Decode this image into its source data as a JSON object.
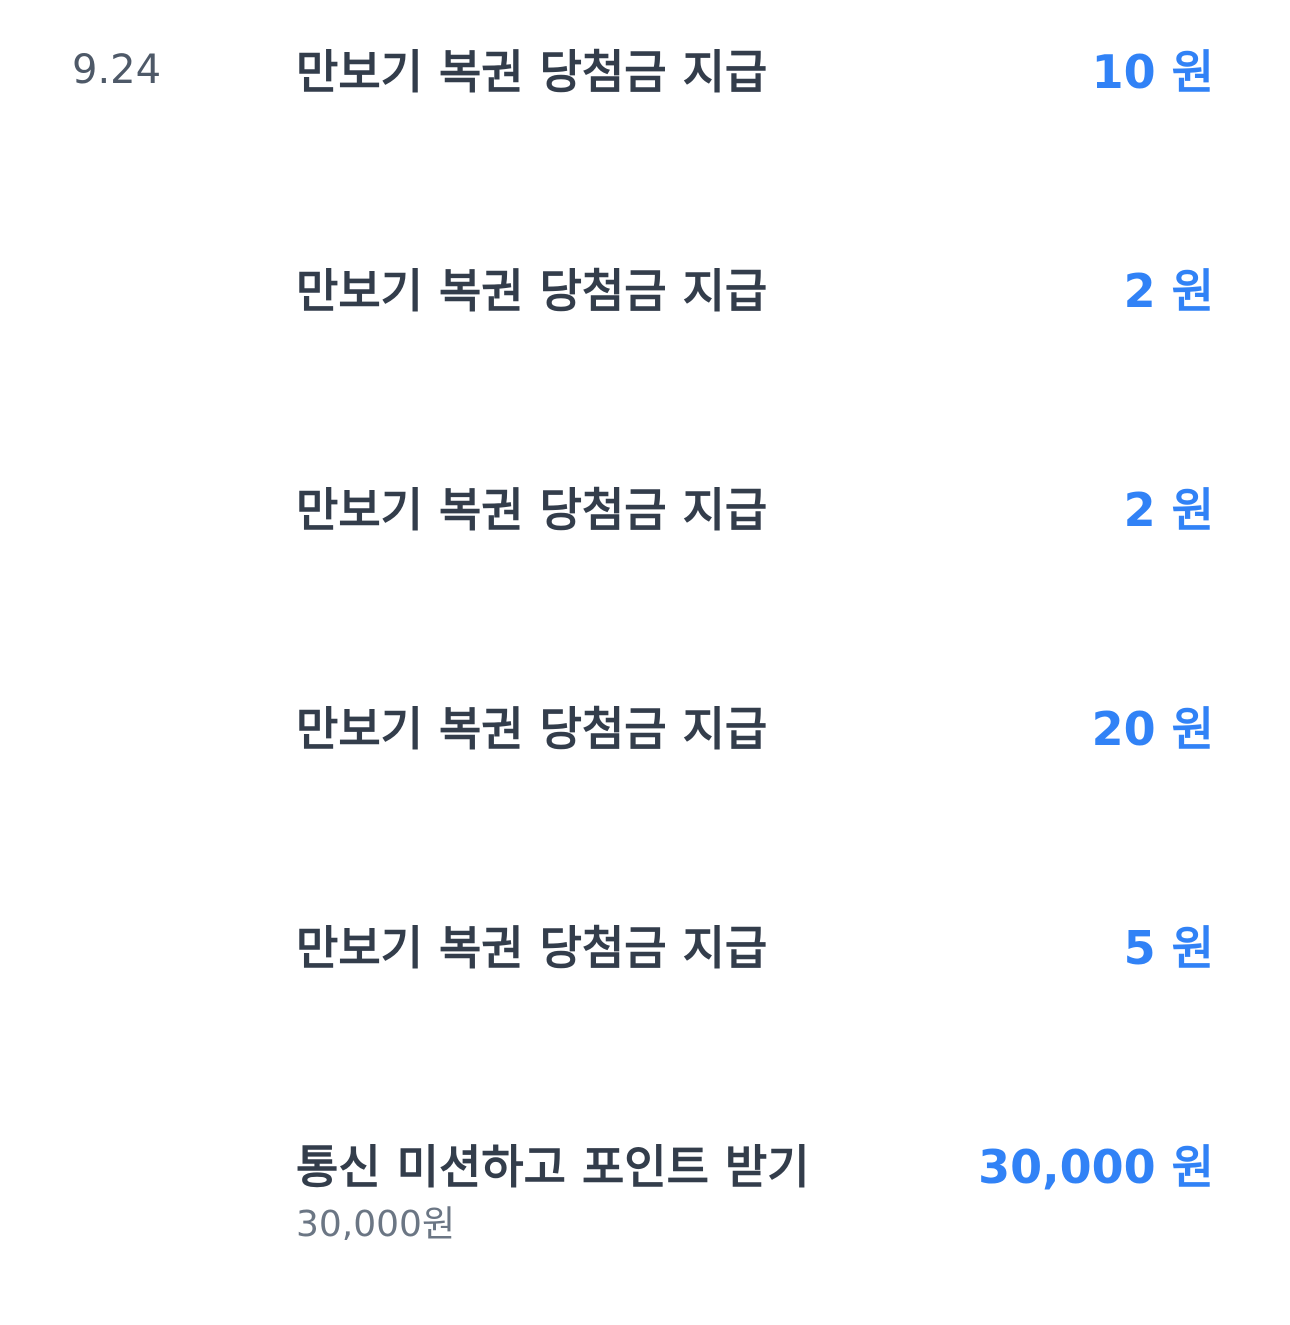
{
  "history": {
    "date": "9.24",
    "items": [
      {
        "title": "만보기 복권 당첨금 지급",
        "amount": "10 원"
      },
      {
        "title": "만보기 복권 당첨금 지급",
        "amount": "2 원"
      },
      {
        "title": "만보기 복권 당첨금 지급",
        "amount": "2 원"
      },
      {
        "title": "만보기 복권 당첨금 지급",
        "amount": "20 원"
      },
      {
        "title": "만보기 복권 당첨금 지급",
        "amount": "5 원"
      },
      {
        "title": "통신 미션하고 포인트 받기",
        "amount": "30,000 원",
        "subtitle": "30,000원"
      }
    ]
  },
  "colors": {
    "title": "#333d4b",
    "amount": "#3182f6",
    "date": "#4e5968",
    "subtitle": "#6b7684"
  }
}
